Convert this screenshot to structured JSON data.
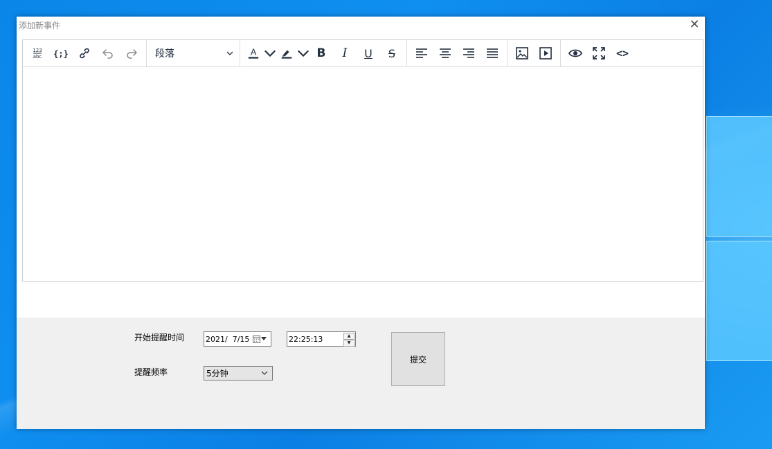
{
  "window": {
    "title": "添加新事件",
    "close_glyph": "✕"
  },
  "toolbar": {
    "word_count_icon": "word-count-icon",
    "format_select": "段落",
    "font_color_letter": "A",
    "bold": "B",
    "italic": "I",
    "underline": "U",
    "strikethrough": "S",
    "source_code": "<>"
  },
  "form": {
    "start_label": "开始提醒时间",
    "date_value": "2021/  7/15",
    "time_value": "22:25:13",
    "frequency_label": "提醒频率",
    "frequency_value": "5分钟",
    "submit_label": "提交"
  },
  "colors": {
    "accent_desktop": "#0a86e8",
    "font_color_underline": "#222f3e",
    "panel_bg": "#f0f0f0"
  }
}
